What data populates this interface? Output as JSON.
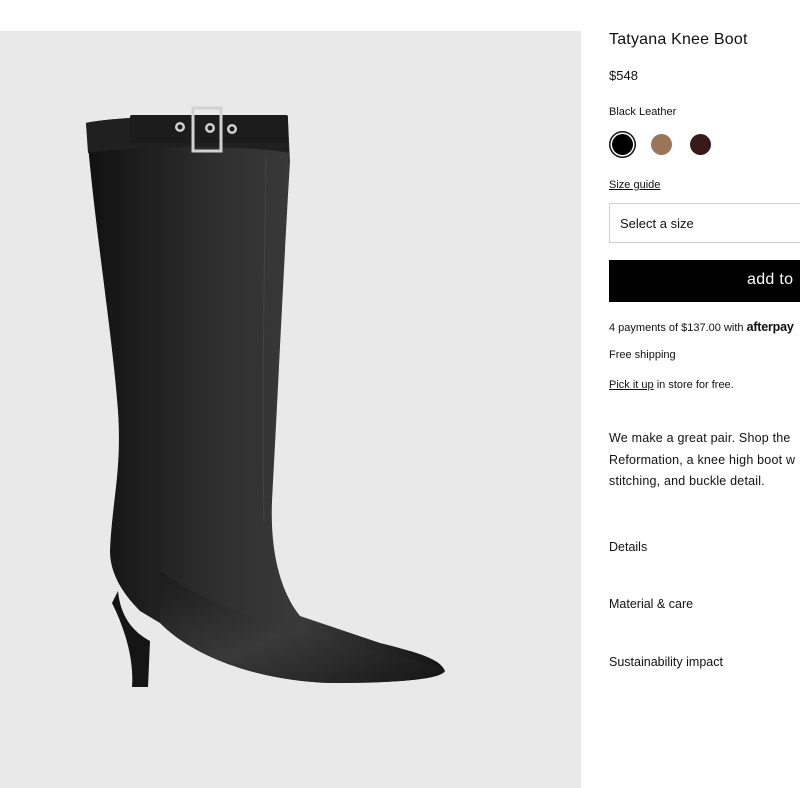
{
  "product": {
    "title": "Tatyana Knee Boot",
    "price": "$548",
    "color_name": "Black Leather",
    "swatches": [
      {
        "name": "black",
        "color": "#000000",
        "selected": true
      },
      {
        "name": "tan",
        "color": "#9a7558",
        "selected": false
      },
      {
        "name": "dark-brown",
        "color": "#3a1a18",
        "selected": false
      }
    ],
    "size_guide_label": "Size guide",
    "size_select_placeholder": "Select a size",
    "add_button_label": "add to",
    "payments_text": "4 payments of $137.00 with",
    "afterpay_label": "afterpay",
    "free_shipping": "Free shipping",
    "pickup_link": "Pick it up",
    "pickup_text": " in store for free.",
    "description_lines": [
      "We make a great pair. Shop the",
      "Reformation, a knee high boot w",
      "stitching, and buckle detail."
    ],
    "accordions": [
      "Details",
      "Material & care",
      "Sustainability impact"
    ]
  },
  "colors": {
    "image_background": "#e9e9e9",
    "button_background": "#000000"
  }
}
